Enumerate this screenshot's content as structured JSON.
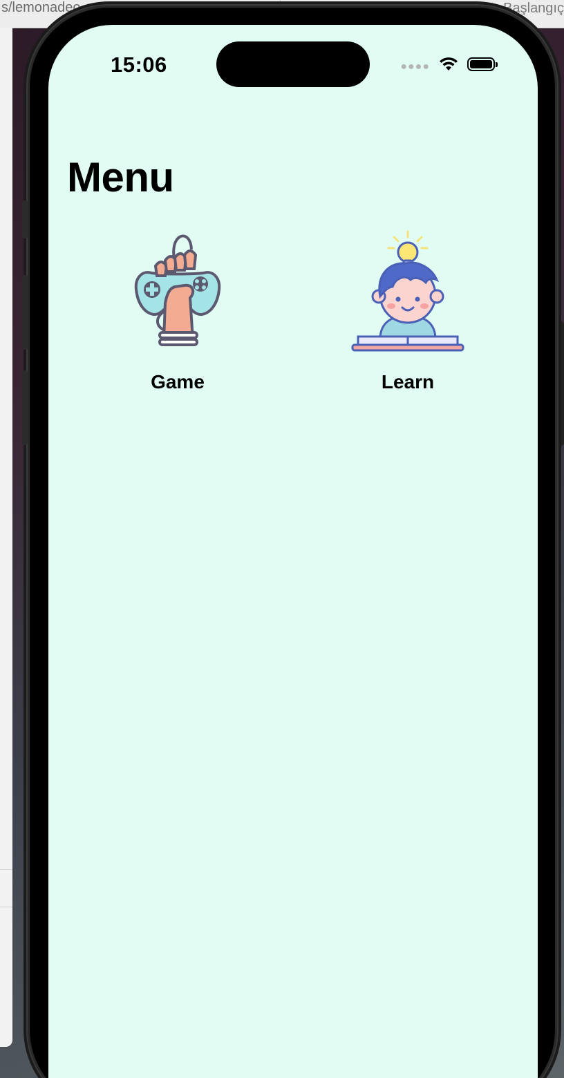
{
  "browser": {
    "url_fragment": "s/lemonadeo",
    "bookmark_label": "Başlangıç"
  },
  "status_bar": {
    "time": "15:06"
  },
  "screen": {
    "title": "Menu",
    "background": "#e0fcf3",
    "items": [
      {
        "label": "Game",
        "icon": "game-controller-fist-icon"
      },
      {
        "label": "Learn",
        "icon": "reading-child-lightbulb-icon"
      }
    ]
  }
}
